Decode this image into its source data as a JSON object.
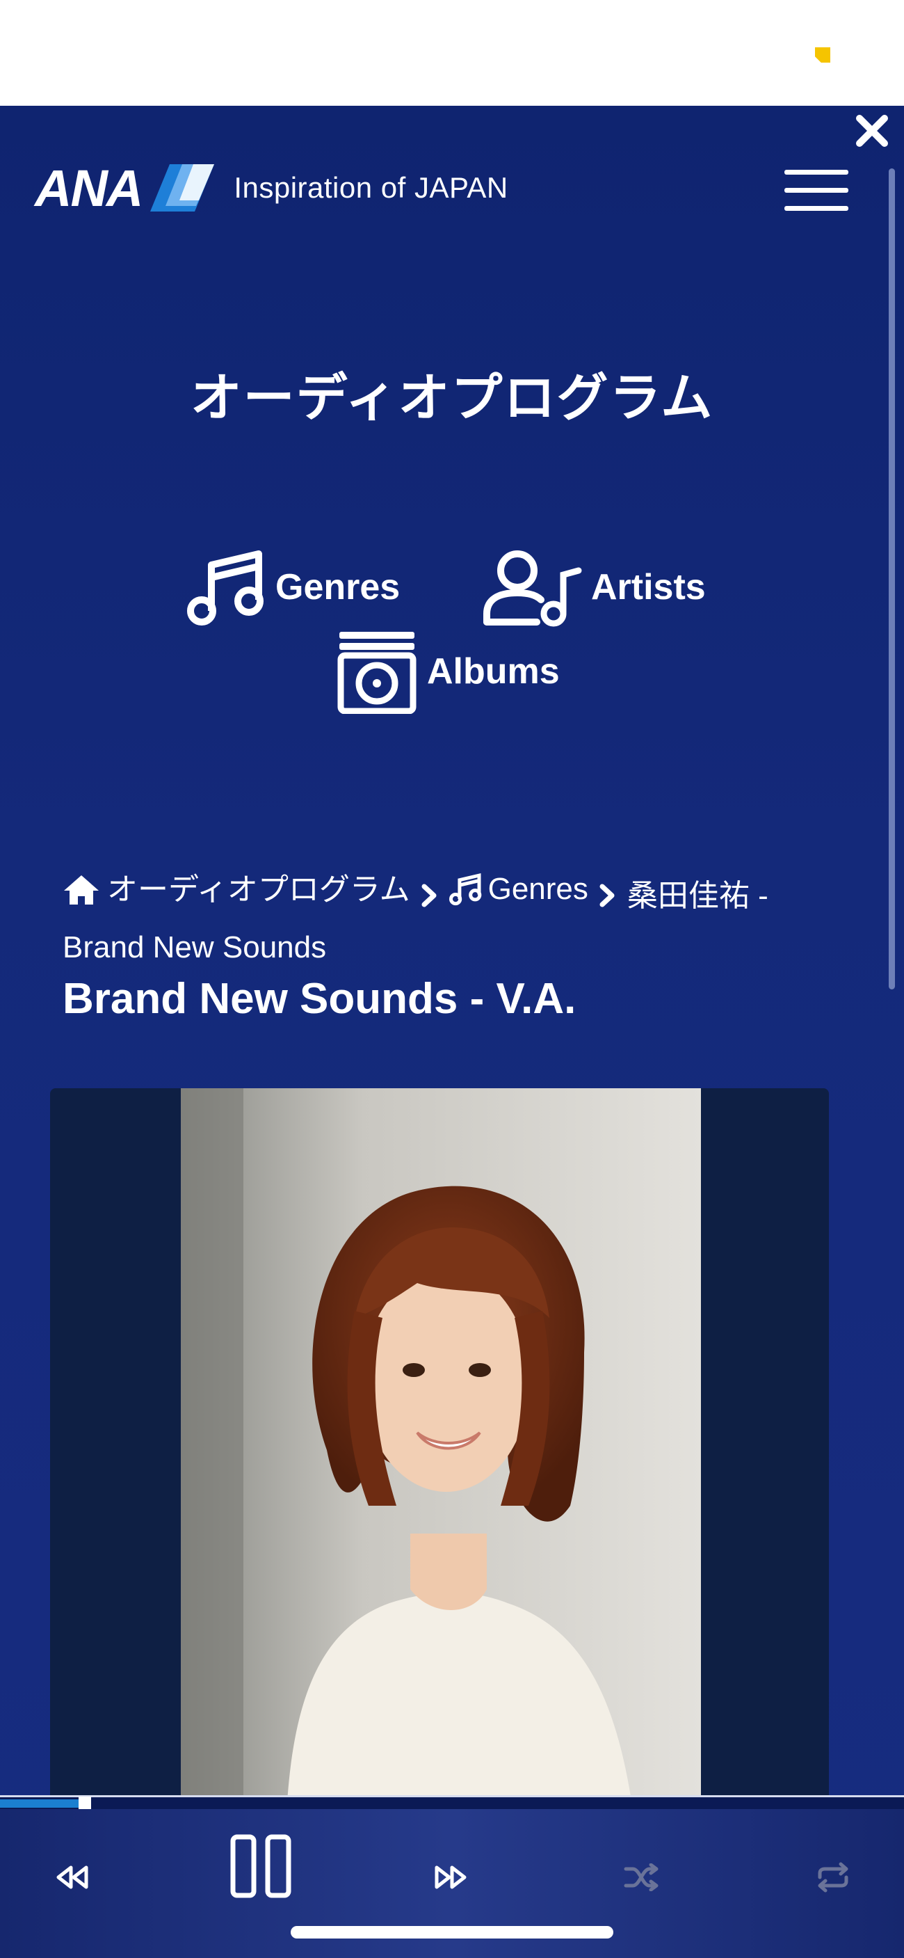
{
  "header": {
    "logo_text": "ANA",
    "tagline": "Inspiration of JAPAN"
  },
  "page": {
    "title": "オーディオプログラム"
  },
  "nav": {
    "genres": "Genres",
    "artists": "Artists",
    "albums": "Albums"
  },
  "breadcrumb": {
    "home": "オーディオプログラム",
    "genres": "Genres",
    "current": "桑田佳祐 - Brand New Sounds"
  },
  "album": {
    "title": "Brand New Sounds - V.A."
  },
  "player": {
    "progress": 0.09,
    "state": "playing"
  },
  "colors": {
    "background": "#14297a",
    "player_bar": "#263a8a",
    "progress_fill": "#1b7fd0",
    "status_accent": "#f5c400"
  },
  "icons": [
    "close-icon",
    "menu-icon",
    "music-note-icon",
    "artist-icon",
    "album-icon",
    "home-icon",
    "chevron-right-icon",
    "rewind-icon",
    "pause-icon",
    "fast-forward-icon",
    "shuffle-icon",
    "repeat-icon"
  ]
}
